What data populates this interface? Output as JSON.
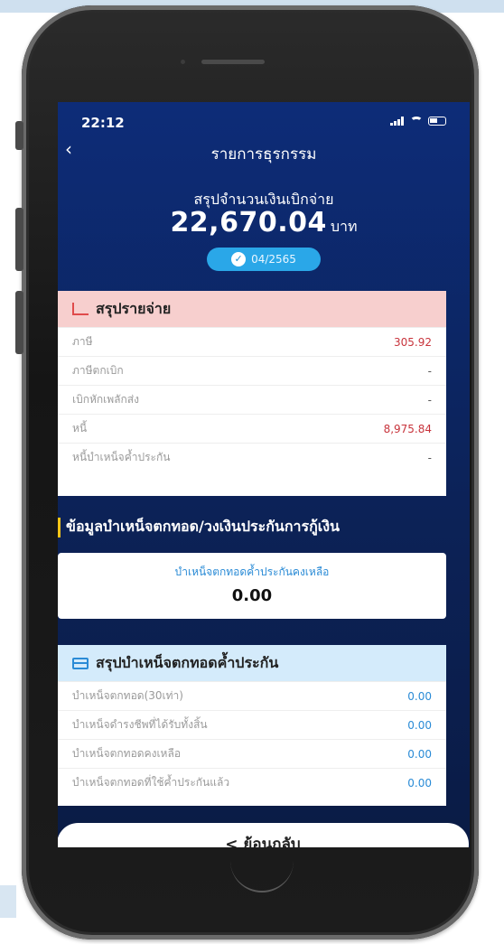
{
  "status_bar": {
    "time": "22:12"
  },
  "nav": {
    "title": "รายการธุรกรรม",
    "back_icon": "chevron-left-icon"
  },
  "summary": {
    "label": "สรุปจำนวนเงินเบิกจ่าย",
    "amount": "22,670.04",
    "unit": "บาท",
    "period": "04/2565"
  },
  "expense_card": {
    "title": "สรุปรายจ่าย",
    "icon": "chart-icon",
    "rows": [
      {
        "label": "ภาษี",
        "value": "305.92",
        "color": "#c8343c"
      },
      {
        "label": "ภาษีตกเบิก",
        "value": "-",
        "color": "#555555"
      },
      {
        "label": "เบิกหักเพลักส่ง",
        "value": "-",
        "color": "#555555"
      },
      {
        "label": "หนี้",
        "value": "8,975.84",
        "color": "#c8343c"
      },
      {
        "label": "หนี้บำเหน็จค้ำประกัน",
        "value": "-",
        "color": "#555555"
      }
    ]
  },
  "guarantee_section": {
    "title": "ข้อมูลบำเหน็จตกทอด/วงเงินประกันการกู้เงิน"
  },
  "remaining_card": {
    "label": "บำเหน็จตกทอดค้ำประกันคงเหลือ",
    "value": "0.00"
  },
  "deposit_card": {
    "title": "สรุปบำเหน็จตกทอดค้ำประกัน",
    "icon": "card-icon",
    "rows": [
      {
        "label": "บำเหน็จตกทอด(30เท่า)",
        "value": "0.00"
      },
      {
        "label": "บำเหน็จดำรงชีพที่ได้รับทั้งสิ้น",
        "value": "0.00"
      },
      {
        "label": "บำเหน็จตกทอดคงเหลือ",
        "value": "0.00"
      },
      {
        "label": "บำเหน็จตกทอดที่ใช้ค้ำประกันแล้ว",
        "value": "0.00"
      }
    ]
  },
  "footer": {
    "back_button_label": "< ย้อนกลับ"
  },
  "colors": {
    "screen_bg": "#0d2c78",
    "badge": "#2aa7e8",
    "expense_header": "#f7cfce",
    "deposit_header": "#d4ebfb",
    "accent_blue": "#2a8bd6",
    "accent_red": "#c8343c",
    "section_bar": "#f5c518"
  }
}
